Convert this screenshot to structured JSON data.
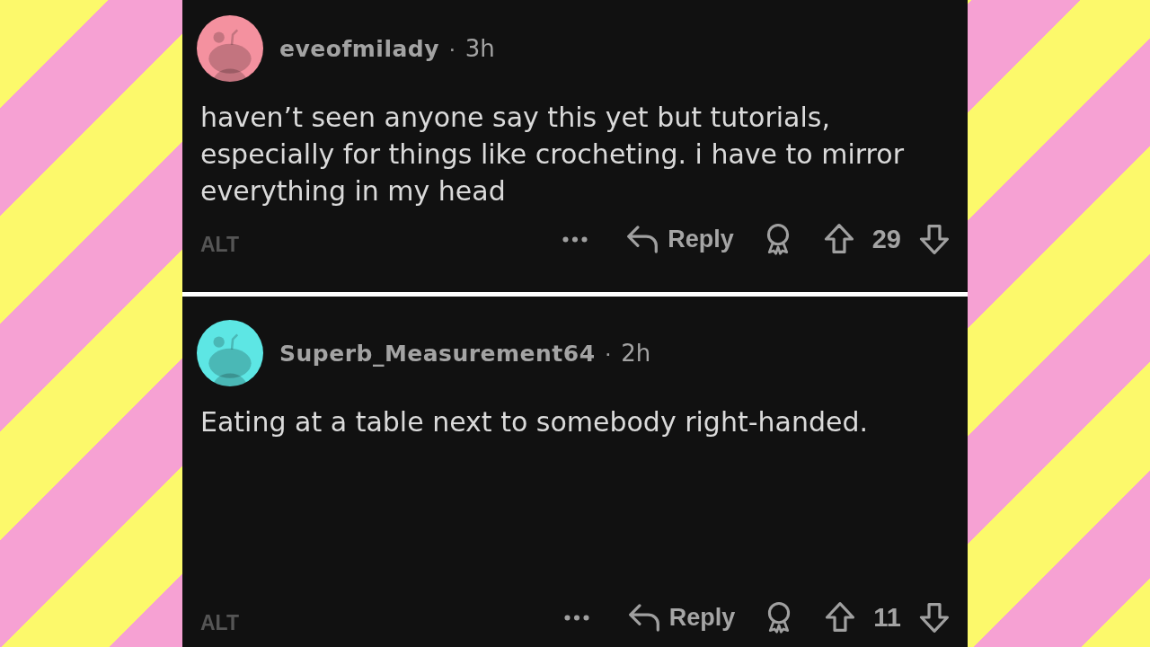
{
  "comments": [
    {
      "username": "eveofmilady",
      "separator": "·",
      "time": "3h",
      "color": "#f4919f",
      "body": "haven’t seen anyone say this yet but tutorials, especially for things like crocheting. i have to mirror everything in my head",
      "alt_badge": "ALT",
      "reply": "Reply",
      "score": "29"
    },
    {
      "username": "Superb_Measurement64",
      "separator": "·",
      "time": "2h",
      "color": "#5de6e4",
      "body": "Eating at a table next to somebody right-handed.",
      "alt_badge": "ALT",
      "reply": "Reply",
      "score": "11"
    }
  ]
}
